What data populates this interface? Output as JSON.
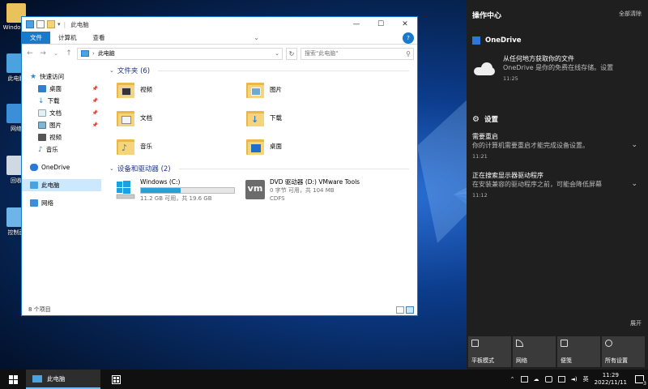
{
  "desktop": {
    "icons": [
      {
        "label": "Windo\nUs",
        "icon": "user-folder-icon"
      },
      {
        "label": "此电脑",
        "icon": "this-pc-icon"
      },
      {
        "label": "网络",
        "icon": "network-icon"
      },
      {
        "label": "回收",
        "icon": "recycle-bin-icon"
      },
      {
        "label": "控制面",
        "icon": "control-panel-icon"
      }
    ]
  },
  "explorer": {
    "title": "此电脑",
    "ribbon_tabs": [
      "文件",
      "计算机",
      "查看"
    ],
    "address": "此电脑",
    "search_placeholder": "搜索\"此电脑\"",
    "nav": [
      {
        "label": "快速访问",
        "icon": "star-icon"
      },
      {
        "label": "桌面",
        "icon": "desktop-icon",
        "pinned": true
      },
      {
        "label": "下载",
        "icon": "download-icon",
        "pinned": true
      },
      {
        "label": "文档",
        "icon": "document-icon",
        "pinned": true
      },
      {
        "label": "图片",
        "icon": "picture-icon",
        "pinned": true
      },
      {
        "label": "视频",
        "icon": "video-icon"
      },
      {
        "label": "音乐",
        "icon": "music-icon"
      },
      {
        "label": "OneDrive",
        "icon": "onedrive-icon"
      },
      {
        "label": "此电脑",
        "icon": "this-pc-icon"
      },
      {
        "label": "网络",
        "icon": "network-icon"
      }
    ],
    "folders_header": "文件夹 (6)",
    "folders": [
      {
        "label": "视频",
        "icon": "video-folder-icon"
      },
      {
        "label": "图片",
        "icon": "picture-folder-icon"
      },
      {
        "label": "文档",
        "icon": "document-folder-icon"
      },
      {
        "label": "下载",
        "icon": "download-folder-icon"
      },
      {
        "label": "音乐",
        "icon": "music-folder-icon"
      },
      {
        "label": "桌面",
        "icon": "desktop-folder-icon"
      }
    ],
    "drives_header": "设备和驱动器 (2)",
    "drives": [
      {
        "label": "Windows (C:)",
        "space": "11.2 GB 可用，共 19.6 GB",
        "used_fraction": 0.43,
        "icon": "windows-drive-icon"
      },
      {
        "label": "DVD 驱动器 (D:) VMware Tools",
        "space": "0 字节 可用，共 104 MB",
        "fs": "CDFS",
        "icon": "vmware-dvd-icon"
      }
    ],
    "status": "8 个项目"
  },
  "action_center": {
    "title": "操作中心",
    "clear_all": "全部清除",
    "onedrive_source": "OneDrive",
    "onedrive_title": "从任何地方获取你的文件",
    "onedrive_body": "OneDrive 是你的免费在线存储。设置",
    "onedrive_time": "11:25",
    "settings_source": "设置",
    "notifications": [
      {
        "title": "需要重启",
        "body": "你的计算机需要重启才能完成设备设置。",
        "time": "11:21"
      },
      {
        "title": "正在搜索显示器驱动程序",
        "body": "在安装兼容的驱动程序之前，可能会降低屏幕",
        "time": "11:12"
      }
    ],
    "expand": "展开",
    "quick_actions": [
      {
        "label": "平板模式",
        "icon": "tablet-mode-icon"
      },
      {
        "label": "网络",
        "icon": "network-icon"
      },
      {
        "label": "便笺",
        "icon": "note-icon"
      },
      {
        "label": "所有设置",
        "icon": "settings-icon"
      }
    ]
  },
  "taskbar": {
    "app_label": "此电脑",
    "ime": "英",
    "time": "11:29",
    "date": "2022/11/11",
    "notification_count": "3"
  }
}
